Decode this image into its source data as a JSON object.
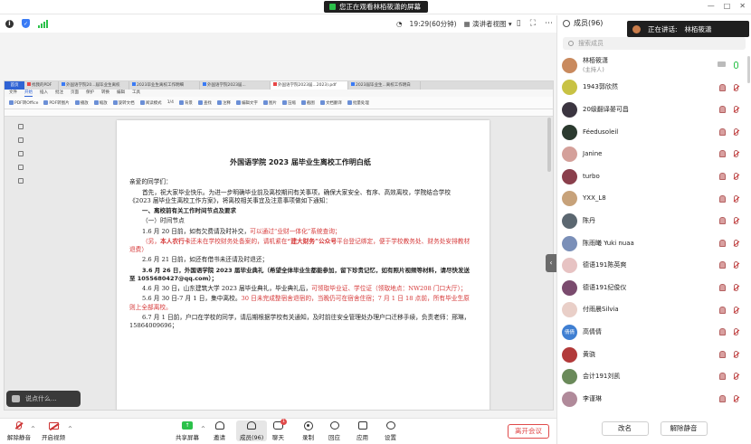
{
  "topbar": {
    "banner_text": "您正在观看林栢筱潇的屏幕",
    "timer": "19:29(60分钟)",
    "view_label": "演讲者视图"
  },
  "shared_doc": {
    "tabs": [
      {
        "label": "首页"
      },
      {
        "label": "找我的PDF"
      },
      {
        "label": "外国语学院20...届毕业生离校"
      },
      {
        "label": "2023毕业生离校工作明细"
      },
      {
        "label": "外国语学院2023届..."
      },
      {
        "label": "外国语学院2023届...2023).pdf",
        "active": true
      },
      {
        "label": "2023届毕业生...离校工作明白"
      }
    ],
    "menu": [
      "文件",
      "开始",
      "插入",
      "批注",
      "页面",
      "保护",
      "转换",
      "编辑",
      "工具"
    ],
    "menu_selected": "开始",
    "ribbon": [
      "PDF转Office",
      "PDF转图片",
      "播放",
      "缩放",
      "旋转文档",
      "阅读模式",
      "背景",
      "查找",
      "注释",
      "编辑文字",
      "图片",
      "压缩",
      "截图",
      "文档翻译",
      "批量处理"
    ],
    "page_info": "1/4",
    "title": "外国语学院 2023 届毕业生离校工作明白纸",
    "greeting": "亲爱的同学们：",
    "intro": "首先，祝大家毕业快乐。为进一步明确毕业前及离校期间有关事项，确保大家安全、有序、高效离校，学院结合学校《2023 届毕业生离校工作方案》，将离校相关事宜及注意事项做如下通知：",
    "section1": "一、离校前有关工作时间节点及要求",
    "subsection1": "（一）时间节点",
    "item1_a": "1.6 月 20 日前，如有欠费请及时补交，",
    "item1_b": "可以通过“业财一体化”系统查询；",
    "item1_note_a": "（另，",
    "item1_note_b": "本人农行卡",
    "item1_note_c": "还未在学校财务处备案的，请机紧在",
    "item1_note_d": "“建大财务”公众号",
    "item1_note_e": "平台登记绑定，便于学校教务处、财务处安排教材退费）",
    "item2": "2.6 月 21 日前，如还有借书未还请及时退还；",
    "item3_a": "3.6 月 26 日，外国语学院 2023 届毕业典礼（希望全体毕业生都能参加，留下珍贵记忆，如有照片视频等材料，请尽快发送至 1055680427@qq.com）；",
    "item4_a": "4.6 月 30 日，山东建筑大学 2023 届毕业典礼，毕业典礼后，",
    "item4_b": "可领取毕业证、学位证（领取地点：NW208 门口大厅）；",
    "item5_a": "5.6 月 30 日-7 月 1 日，集中离校。",
    "item5_b": "30 日未完成整宿舍退宿的，当晚仍可在宿舍住宿；7 月 1 日 18 点前，",
    "item5_c": "所有毕业生原则上全部离校。",
    "item6": "6.7 月 1 日前，户口在学校的同学，请后期根据学校有关通知，及时前往安全管理处办理户口迁移手续，负责老师：邢琳，15864009696；"
  },
  "chat_input_placeholder": "说点什么...",
  "panel": {
    "title": "成员(96)",
    "speaking_label": "正在讲话:",
    "speaking_name": "林栢筱潇",
    "search_placeholder": "搜索成员",
    "members": [
      {
        "name": "林栢筱潇",
        "role": "(主持人)",
        "avatar_color": "#c98a5e",
        "avatar_text": "",
        "mic": "on"
      },
      {
        "name": "1943郭欣然",
        "role": "",
        "avatar_color": "#c8c244",
        "avatar_text": "",
        "mic": "off"
      },
      {
        "name": "20级翻译晏可昌",
        "role": "",
        "avatar_color": "#3b3540",
        "avatar_text": "",
        "mic": "off"
      },
      {
        "name": "Féedusoleil",
        "role": "",
        "avatar_color": "#2b3a2f",
        "avatar_text": "",
        "mic": "off"
      },
      {
        "name": "Janine",
        "role": "",
        "avatar_color": "#d4a09a",
        "avatar_text": "",
        "mic": "off"
      },
      {
        "name": "turbo",
        "role": "",
        "avatar_color": "#8a3f4c",
        "avatar_text": "",
        "mic": "off"
      },
      {
        "name": "YXX_L8",
        "role": "",
        "avatar_color": "#c7a27a",
        "avatar_text": "",
        "mic": "off"
      },
      {
        "name": "陈丹",
        "role": "",
        "avatar_color": "#5b6770",
        "avatar_text": "",
        "mic": "off"
      },
      {
        "name": "陈雨曦 Yuki nuaa",
        "role": "",
        "avatar_color": "#7a8fb8",
        "avatar_text": "",
        "mic": "off"
      },
      {
        "name": "德语191陈英爽",
        "role": "",
        "avatar_color": "#e7c3c3",
        "avatar_text": "",
        "mic": "off"
      },
      {
        "name": "德语191纪俊仪",
        "role": "",
        "avatar_color": "#7a4b6e",
        "avatar_text": "",
        "mic": "off"
      },
      {
        "name": "付雨晨Silvia",
        "role": "",
        "avatar_color": "#e9cfc8",
        "avatar_text": "",
        "mic": "off"
      },
      {
        "name": "高倩倩",
        "role": "",
        "avatar_color": "#3f7fd2",
        "avatar_text": "倩倩",
        "mic": "off"
      },
      {
        "name": "黄骁",
        "role": "",
        "avatar_color": "#b23a3a",
        "avatar_text": "",
        "mic": "off"
      },
      {
        "name": "会计191刘凯",
        "role": "",
        "avatar_color": "#6a8a5a",
        "avatar_text": "",
        "mic": "off"
      },
      {
        "name": "李谨琳",
        "role": "",
        "avatar_color": "#b08a9a",
        "avatar_text": "",
        "mic": "off"
      }
    ],
    "rename_label": "改名",
    "unmute_label": "解除静音"
  },
  "toolbar": {
    "unmute": "解除静音",
    "start_video": "开启视频",
    "share": "共享屏幕",
    "invite": "邀请",
    "members": "成员(96)",
    "chat": "聊天",
    "chat_badge": "1",
    "record": "录制",
    "reactions": "回应",
    "apps": "应用",
    "settings": "设置",
    "leave": "离开会议"
  }
}
